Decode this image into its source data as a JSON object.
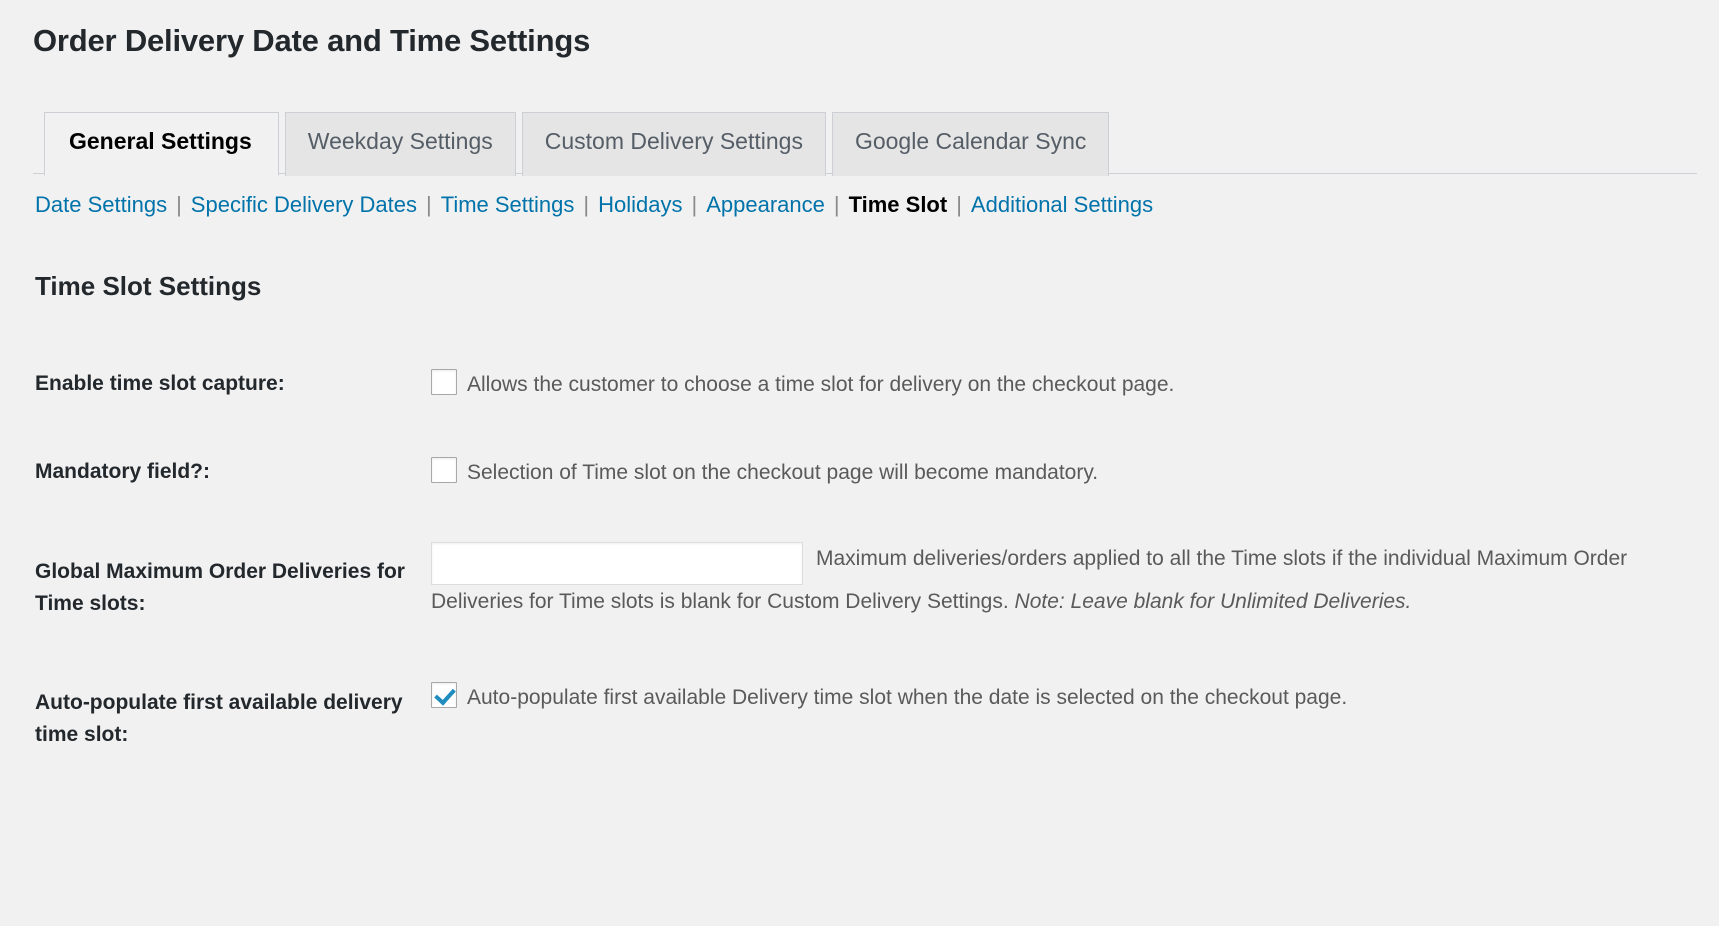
{
  "page": {
    "title": "Order Delivery Date and Time Settings",
    "section_heading": "Time Slot Settings"
  },
  "colors": {
    "background": "#f1f1f1",
    "link": "#0073aa",
    "heading": "#23282d",
    "tab_inactive_bg": "#e5e5e5",
    "tab_border": "#ccd0d4",
    "checkbox_check": "#1e8cbe",
    "body_text": "#5a5a5a"
  },
  "tabs": [
    {
      "label": "General Settings",
      "active": true
    },
    {
      "label": "Weekday Settings",
      "active": false
    },
    {
      "label": "Custom Delivery Settings",
      "active": false
    },
    {
      "label": "Google Calendar Sync",
      "active": false
    }
  ],
  "subnav": {
    "separator": "|",
    "items": [
      {
        "label": "Date Settings",
        "current": false
      },
      {
        "label": "Specific Delivery Dates",
        "current": false
      },
      {
        "label": "Time Settings",
        "current": false
      },
      {
        "label": "Holidays",
        "current": false
      },
      {
        "label": "Appearance",
        "current": false
      },
      {
        "label": "Time Slot",
        "current": true
      },
      {
        "label": "Additional Settings",
        "current": false
      }
    ]
  },
  "settings": {
    "enable_time_slot": {
      "label": "Enable time slot capture:",
      "checked": false,
      "description": "Allows the customer to choose a time slot for delivery on the checkout page."
    },
    "mandatory_field": {
      "label": "Mandatory field?:",
      "checked": false,
      "description": "Selection of Time slot on the checkout page will become mandatory."
    },
    "global_max_deliveries": {
      "label": "Global Maximum Order Deliveries for Time slots:",
      "value": "",
      "placeholder": "",
      "description": "Maximum deliveries/orders applied to all the Time slots if the individual Maximum Order Deliveries for Time slots is blank for Custom Delivery Settings.",
      "note": "Note: Leave blank for Unlimited Deliveries."
    },
    "auto_populate": {
      "label": "Auto-populate first available delivery time slot:",
      "checked": true,
      "description": "Auto-populate first available Delivery time slot when the date is selected on the checkout page."
    }
  }
}
